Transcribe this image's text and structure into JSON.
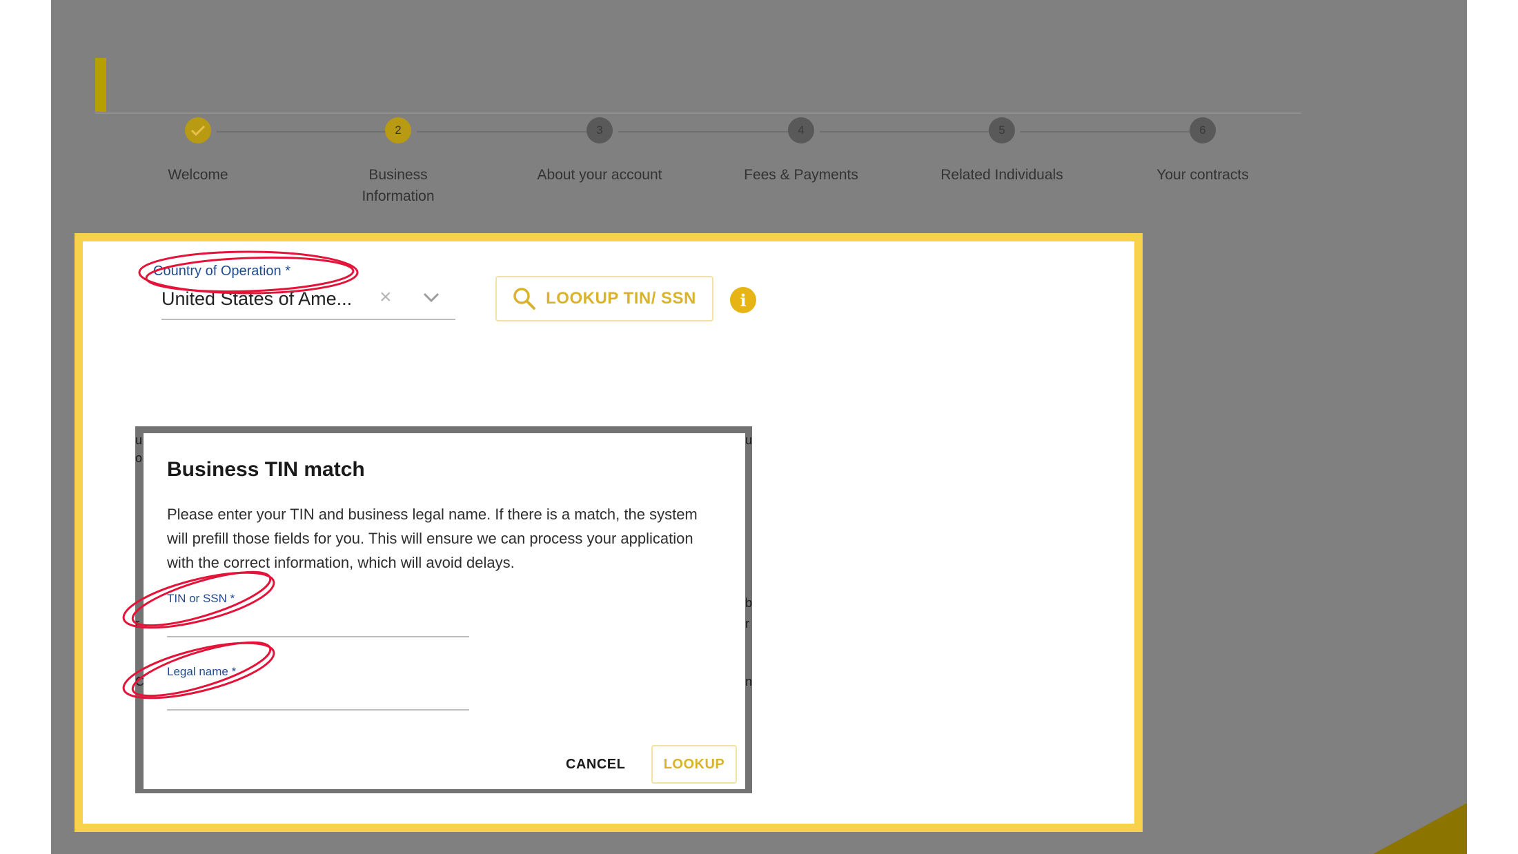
{
  "colors": {
    "accent": "#d9b32b",
    "step_done": "#b89a13",
    "step_pending": "#595959",
    "highlight_frame": "#f8d24a",
    "annotation_red": "#e3143a",
    "label_blue": "#1f4b8f"
  },
  "stepper": {
    "steps": [
      {
        "number": "",
        "icon": "check-icon",
        "label": "Welcome",
        "status": "done"
      },
      {
        "number": "2",
        "label": "Business Information",
        "status": "active"
      },
      {
        "number": "3",
        "label": "About your account",
        "status": "pending"
      },
      {
        "number": "4",
        "label": "Fees & Payments",
        "status": "pending"
      },
      {
        "number": "5",
        "label": "Related Individuals",
        "status": "pending"
      },
      {
        "number": "6",
        "label": "Your contracts",
        "status": "pending"
      }
    ]
  },
  "form": {
    "country_label": "Country of Operation *",
    "country_value": "United States of Ame...",
    "clear_icon": "×",
    "lookup_button_label": "LOOKUP TIN/ SSN",
    "info_icon": "i"
  },
  "modal": {
    "title": "Business TIN match",
    "description": "Please enter your TIN and business legal name. If there is a match, the system will prefill those fields for you. This will ensure we can process your application with the correct information, which will avoid delays.",
    "tin_label": "TIN or SSN *",
    "tin_value": "",
    "legal_name_label": "Legal name *",
    "legal_name_value": "",
    "cancel_label": "CANCEL",
    "lookup_label": "LOOKUP"
  },
  "backdrop_fragments": [
    "u",
    "o",
    "b",
    "r",
    "r",
    "C",
    "n",
    "u"
  ]
}
